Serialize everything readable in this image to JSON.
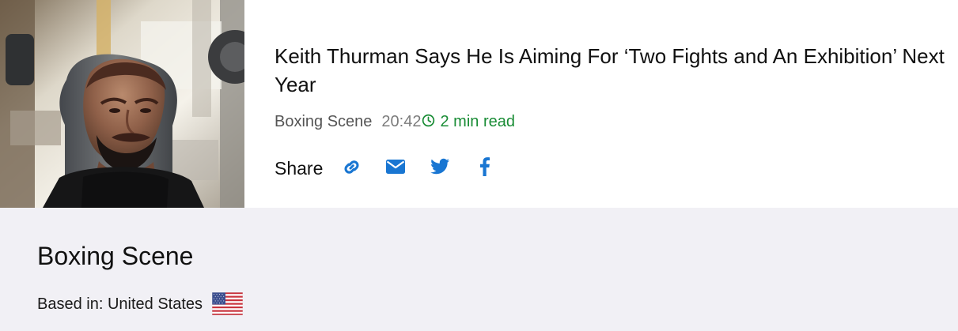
{
  "article": {
    "headline": "Keith Thurman Says He Is Aiming For ‘Two Fights and An Exhibition’ Next Year",
    "source": "Boxing Scene",
    "time": "20:42",
    "read_time": "2 min read",
    "share_label": "Share",
    "image_icon": "boxer-photo",
    "share_icons": [
      "link-icon",
      "email-icon",
      "twitter-icon",
      "facebook-icon"
    ]
  },
  "source_profile": {
    "name": "Boxing Scene",
    "based_in": "Based in: United States",
    "flag_icon": "us-flag-icon"
  },
  "colors": {
    "link_blue": "#1976d2",
    "read_green": "#198c35",
    "section_background": "#f1f0f5"
  }
}
